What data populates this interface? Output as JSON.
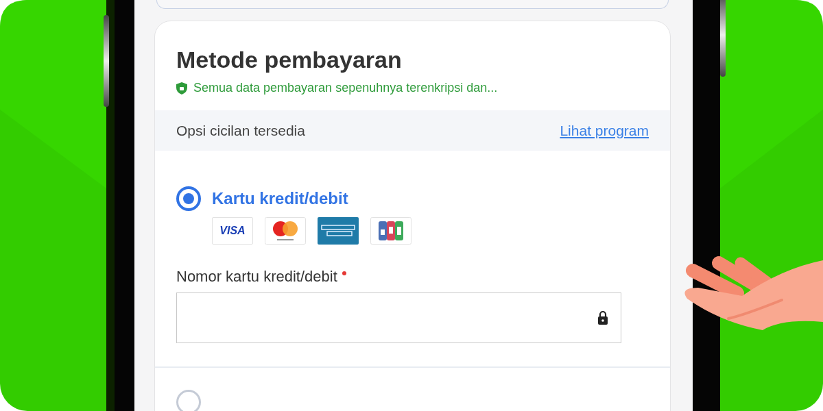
{
  "payment": {
    "title": "Metode pembayaran",
    "security_note": "Semua data pembayaran sepenuhnya terenkripsi dan...",
    "installment_banner": {
      "text": "Opsi cicilan tersedia",
      "link": "Lihat program"
    },
    "options": [
      {
        "kind": "card",
        "label": "Kartu kredit/debit",
        "selected": true,
        "brands": [
          {
            "kind": "visa",
            "text": "VISA"
          },
          {
            "kind": "mastercard"
          },
          {
            "kind": "amex"
          },
          {
            "kind": "jcb"
          }
        ],
        "field": {
          "label": "Nomor kartu kredit/debit",
          "required": true
        }
      },
      {
        "kind": "other",
        "selected": false
      }
    ]
  }
}
